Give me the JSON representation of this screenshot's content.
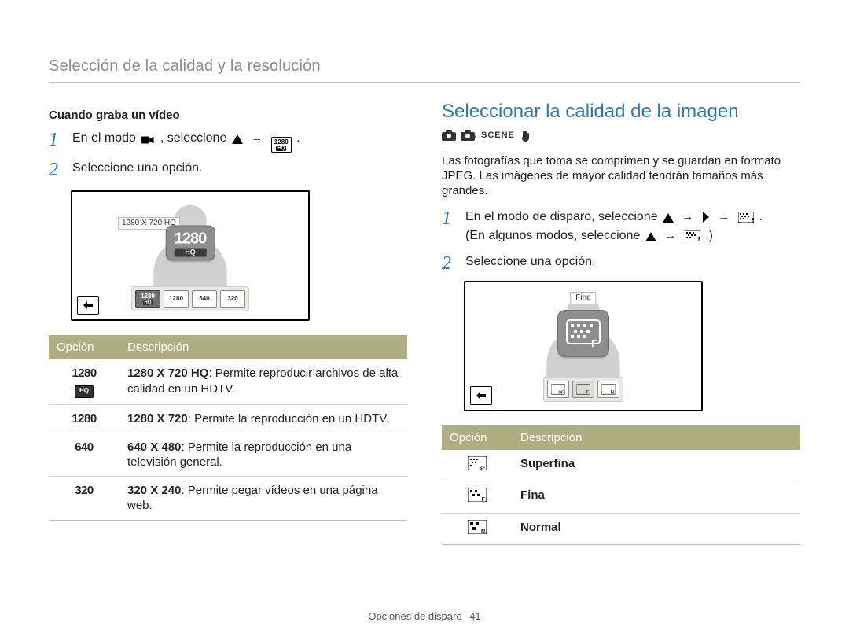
{
  "header": "Selección de la calidad y la resolución",
  "left": {
    "subhead": "Cuando graba un vídeo",
    "step1_a": "En el modo",
    "step1_b": ", seleccione",
    "step1_c": ".",
    "step2": "Seleccione una opción.",
    "preview_label": "1280 X 720 HQ",
    "thumbs": [
      "1280",
      "1280",
      "640",
      "320"
    ],
    "thumbs_sub": [
      "HQ",
      "",
      "",
      ""
    ],
    "table": {
      "head": {
        "opt": "Opción",
        "desc": "Descripción"
      },
      "rows": [
        {
          "opt": "1280 HQ",
          "opt_label": "1280",
          "opt_sub": "HQ",
          "desc_bold": "1280 X 720 HQ",
          "desc": ": Permite reproducir archivos de alta calidad en un HDTV."
        },
        {
          "opt": "1280",
          "opt_label": "1280",
          "opt_sub": "",
          "desc_bold": "1280 X 720",
          "desc": ": Permite la reproducción en un HDTV."
        },
        {
          "opt": "640",
          "opt_label": "640",
          "opt_sub": "",
          "desc_bold": "640 X 480",
          "desc": ": Permite la reproducción en una televisión general."
        },
        {
          "opt": "320",
          "opt_label": "320",
          "opt_sub": "",
          "desc_bold": "320 X 240",
          "desc": ": Permite pegar vídeos en una página web."
        }
      ]
    }
  },
  "right": {
    "title": "Seleccionar la calidad de la imagen",
    "intro": "Las fotografías que toma se comprimen y se guardan en formato JPEG. Las imágenes de mayor calidad tendrán tamaños más grandes.",
    "step1_a": "En el modo de disparo, seleccione",
    "step1_b": ".",
    "step1_c": "(En algunos modos, seleccione",
    "step1_d": ".)",
    "step2": "Seleccione una opción.",
    "preview_label": "Fina",
    "table": {
      "head": {
        "opt": "Opción",
        "desc": "Descripción"
      },
      "rows": [
        {
          "key": "SF",
          "desc": "Superfina"
        },
        {
          "key": "F",
          "desc": "Fina"
        },
        {
          "key": "N",
          "desc": "Normal"
        }
      ]
    }
  },
  "footer": {
    "section": "Opciones de disparo",
    "page": "41"
  }
}
